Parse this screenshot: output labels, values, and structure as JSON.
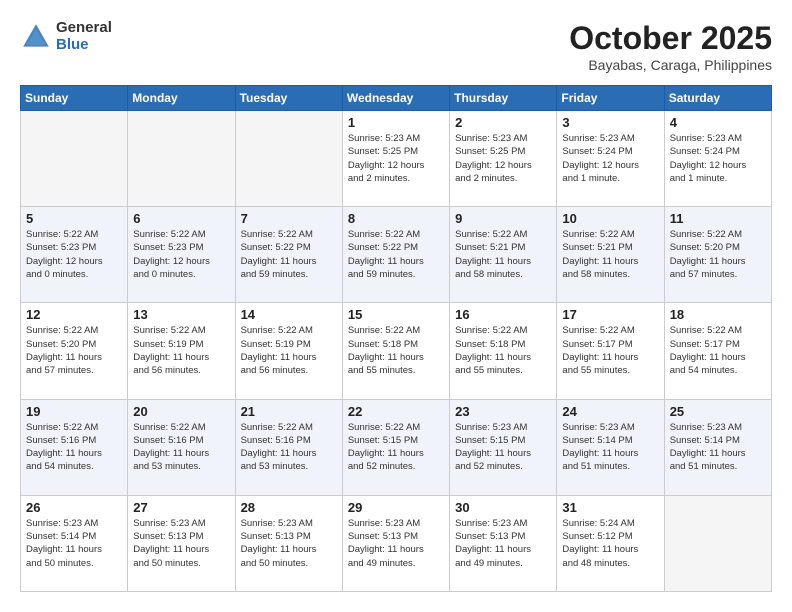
{
  "header": {
    "logo": {
      "general": "General",
      "blue": "Blue"
    },
    "title": "October 2025",
    "location": "Bayabas, Caraga, Philippines"
  },
  "days_of_week": [
    "Sunday",
    "Monday",
    "Tuesday",
    "Wednesday",
    "Thursday",
    "Friday",
    "Saturday"
  ],
  "weeks": [
    {
      "alt": false,
      "days": [
        {
          "num": "",
          "info": "",
          "empty": true
        },
        {
          "num": "",
          "info": "",
          "empty": true
        },
        {
          "num": "",
          "info": "",
          "empty": true
        },
        {
          "num": "1",
          "info": "Sunrise: 5:23 AM\nSunset: 5:25 PM\nDaylight: 12 hours\nand 2 minutes.",
          "empty": false
        },
        {
          "num": "2",
          "info": "Sunrise: 5:23 AM\nSunset: 5:25 PM\nDaylight: 12 hours\nand 2 minutes.",
          "empty": false
        },
        {
          "num": "3",
          "info": "Sunrise: 5:23 AM\nSunset: 5:24 PM\nDaylight: 12 hours\nand 1 minute.",
          "empty": false
        },
        {
          "num": "4",
          "info": "Sunrise: 5:23 AM\nSunset: 5:24 PM\nDaylight: 12 hours\nand 1 minute.",
          "empty": false
        }
      ]
    },
    {
      "alt": true,
      "days": [
        {
          "num": "5",
          "info": "Sunrise: 5:22 AM\nSunset: 5:23 PM\nDaylight: 12 hours\nand 0 minutes.",
          "empty": false
        },
        {
          "num": "6",
          "info": "Sunrise: 5:22 AM\nSunset: 5:23 PM\nDaylight: 12 hours\nand 0 minutes.",
          "empty": false
        },
        {
          "num": "7",
          "info": "Sunrise: 5:22 AM\nSunset: 5:22 PM\nDaylight: 11 hours\nand 59 minutes.",
          "empty": false
        },
        {
          "num": "8",
          "info": "Sunrise: 5:22 AM\nSunset: 5:22 PM\nDaylight: 11 hours\nand 59 minutes.",
          "empty": false
        },
        {
          "num": "9",
          "info": "Sunrise: 5:22 AM\nSunset: 5:21 PM\nDaylight: 11 hours\nand 58 minutes.",
          "empty": false
        },
        {
          "num": "10",
          "info": "Sunrise: 5:22 AM\nSunset: 5:21 PM\nDaylight: 11 hours\nand 58 minutes.",
          "empty": false
        },
        {
          "num": "11",
          "info": "Sunrise: 5:22 AM\nSunset: 5:20 PM\nDaylight: 11 hours\nand 57 minutes.",
          "empty": false
        }
      ]
    },
    {
      "alt": false,
      "days": [
        {
          "num": "12",
          "info": "Sunrise: 5:22 AM\nSunset: 5:20 PM\nDaylight: 11 hours\nand 57 minutes.",
          "empty": false
        },
        {
          "num": "13",
          "info": "Sunrise: 5:22 AM\nSunset: 5:19 PM\nDaylight: 11 hours\nand 56 minutes.",
          "empty": false
        },
        {
          "num": "14",
          "info": "Sunrise: 5:22 AM\nSunset: 5:19 PM\nDaylight: 11 hours\nand 56 minutes.",
          "empty": false
        },
        {
          "num": "15",
          "info": "Sunrise: 5:22 AM\nSunset: 5:18 PM\nDaylight: 11 hours\nand 55 minutes.",
          "empty": false
        },
        {
          "num": "16",
          "info": "Sunrise: 5:22 AM\nSunset: 5:18 PM\nDaylight: 11 hours\nand 55 minutes.",
          "empty": false
        },
        {
          "num": "17",
          "info": "Sunrise: 5:22 AM\nSunset: 5:17 PM\nDaylight: 11 hours\nand 55 minutes.",
          "empty": false
        },
        {
          "num": "18",
          "info": "Sunrise: 5:22 AM\nSunset: 5:17 PM\nDaylight: 11 hours\nand 54 minutes.",
          "empty": false
        }
      ]
    },
    {
      "alt": true,
      "days": [
        {
          "num": "19",
          "info": "Sunrise: 5:22 AM\nSunset: 5:16 PM\nDaylight: 11 hours\nand 54 minutes.",
          "empty": false
        },
        {
          "num": "20",
          "info": "Sunrise: 5:22 AM\nSunset: 5:16 PM\nDaylight: 11 hours\nand 53 minutes.",
          "empty": false
        },
        {
          "num": "21",
          "info": "Sunrise: 5:22 AM\nSunset: 5:16 PM\nDaylight: 11 hours\nand 53 minutes.",
          "empty": false
        },
        {
          "num": "22",
          "info": "Sunrise: 5:22 AM\nSunset: 5:15 PM\nDaylight: 11 hours\nand 52 minutes.",
          "empty": false
        },
        {
          "num": "23",
          "info": "Sunrise: 5:23 AM\nSunset: 5:15 PM\nDaylight: 11 hours\nand 52 minutes.",
          "empty": false
        },
        {
          "num": "24",
          "info": "Sunrise: 5:23 AM\nSunset: 5:14 PM\nDaylight: 11 hours\nand 51 minutes.",
          "empty": false
        },
        {
          "num": "25",
          "info": "Sunrise: 5:23 AM\nSunset: 5:14 PM\nDaylight: 11 hours\nand 51 minutes.",
          "empty": false
        }
      ]
    },
    {
      "alt": false,
      "days": [
        {
          "num": "26",
          "info": "Sunrise: 5:23 AM\nSunset: 5:14 PM\nDaylight: 11 hours\nand 50 minutes.",
          "empty": false
        },
        {
          "num": "27",
          "info": "Sunrise: 5:23 AM\nSunset: 5:13 PM\nDaylight: 11 hours\nand 50 minutes.",
          "empty": false
        },
        {
          "num": "28",
          "info": "Sunrise: 5:23 AM\nSunset: 5:13 PM\nDaylight: 11 hours\nand 50 minutes.",
          "empty": false
        },
        {
          "num": "29",
          "info": "Sunrise: 5:23 AM\nSunset: 5:13 PM\nDaylight: 11 hours\nand 49 minutes.",
          "empty": false
        },
        {
          "num": "30",
          "info": "Sunrise: 5:23 AM\nSunset: 5:13 PM\nDaylight: 11 hours\nand 49 minutes.",
          "empty": false
        },
        {
          "num": "31",
          "info": "Sunrise: 5:24 AM\nSunset: 5:12 PM\nDaylight: 11 hours\nand 48 minutes.",
          "empty": false
        },
        {
          "num": "",
          "info": "",
          "empty": true
        }
      ]
    }
  ]
}
